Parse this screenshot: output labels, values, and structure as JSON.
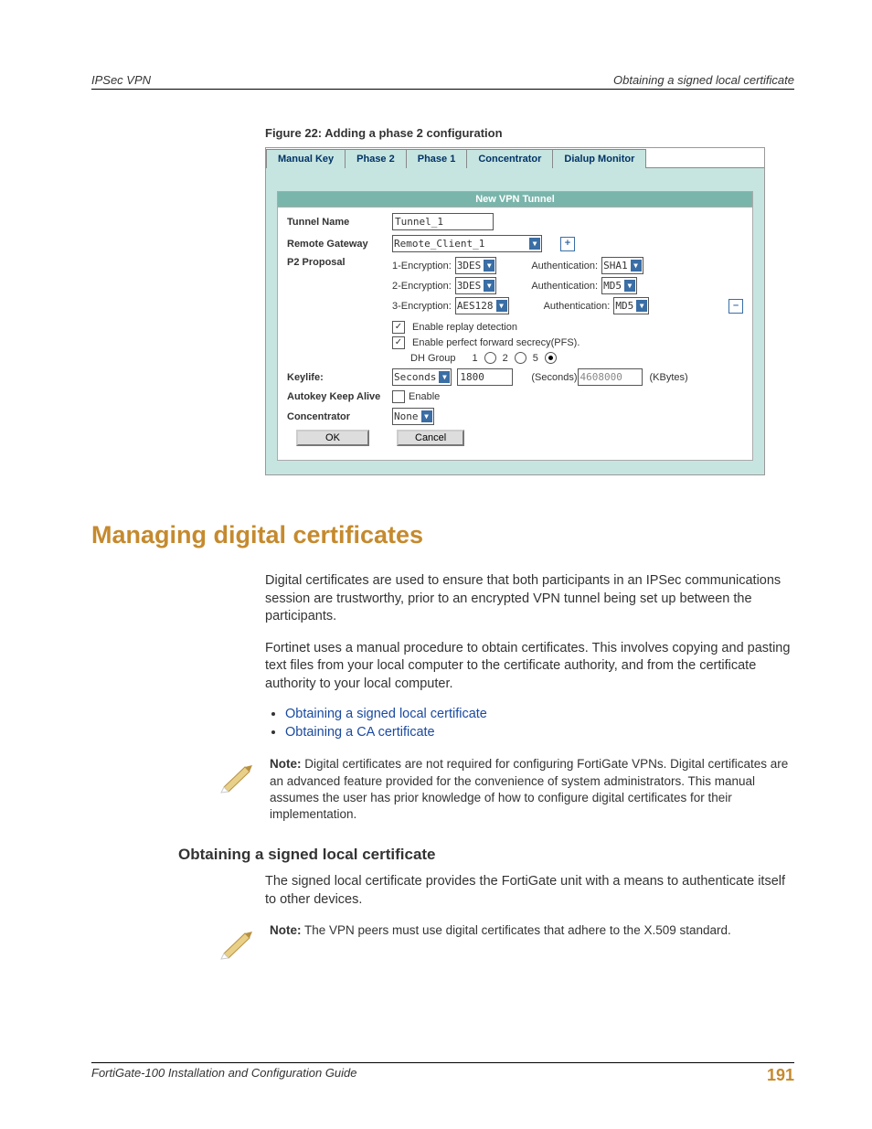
{
  "header": {
    "left": "IPSec VPN",
    "right": "Obtaining a signed local certificate"
  },
  "figure_caption": "Figure 22: Adding a phase 2 configuration",
  "screenshot": {
    "tabs": [
      "Manual Key",
      "Phase 2",
      "Phase 1",
      "Concentrator",
      "Dialup Monitor"
    ],
    "panel_title": "New VPN Tunnel",
    "labels": {
      "tunnel_name": "Tunnel Name",
      "remote_gateway": "Remote Gateway",
      "p2_proposal": "P2 Proposal",
      "keylife": "Keylife:",
      "autokey": "Autokey Keep Alive",
      "concentrator": "Concentrator"
    },
    "values": {
      "tunnel_name": "Tunnel_1",
      "remote_gateway": "Remote_Client_1",
      "enc_label_1": "1-Encryption:",
      "enc_label_2": "2-Encryption:",
      "enc_label_3": "3-Encryption:",
      "enc1": "3DES",
      "enc2": "3DES",
      "enc3": "AES128",
      "auth_label": "Authentication:",
      "auth1": "SHA1",
      "auth2": "MD5",
      "auth3": "MD5",
      "replay_label": "Enable replay detection",
      "pfs_label": "Enable perfect forward secrecy(PFS).",
      "dhgroup_label": "DH Group",
      "dh1": "1",
      "dh2": "2",
      "dh5": "5",
      "keylife_unit": "Seconds",
      "keylife_val": "1800",
      "keylife_sec_label": "(Seconds)",
      "keylife_kbytes": "4608000",
      "keylife_kb_label": "(KBytes)",
      "autokey_enable": "Enable",
      "concentrator_val": "None",
      "ok": "OK",
      "cancel": "Cancel",
      "plus": "+",
      "minus": "–"
    }
  },
  "section_title": "Managing digital certificates",
  "para1": "Digital certificates are used to ensure that both participants in an IPSec communications session are trustworthy, prior to an encrypted VPN tunnel being set up between the participants.",
  "para2": "Fortinet uses a manual procedure to obtain certificates. This involves copying and pasting text files from your local computer to the certificate authority, and from the certificate authority to your local computer.",
  "links": {
    "l1": "Obtaining a signed local certificate",
    "l2": "Obtaining a CA certificate"
  },
  "note1_b": "Note:",
  "note1": " Digital certificates are not required for configuring FortiGate VPNs. Digital certificates are an advanced feature provided for the convenience of system administrators. This manual assumes the user has prior knowledge of how to configure digital certificates for their implementation.",
  "sub_title": "Obtaining a signed local certificate",
  "para3": "The signed local certificate provides the FortiGate unit with a means to authenticate itself to other devices.",
  "note2_b": "Note:",
  "note2": " The VPN peers must use digital certificates that adhere to the X.509 standard.",
  "footer": {
    "left": "FortiGate-100 Installation and Configuration Guide",
    "page": "191"
  }
}
